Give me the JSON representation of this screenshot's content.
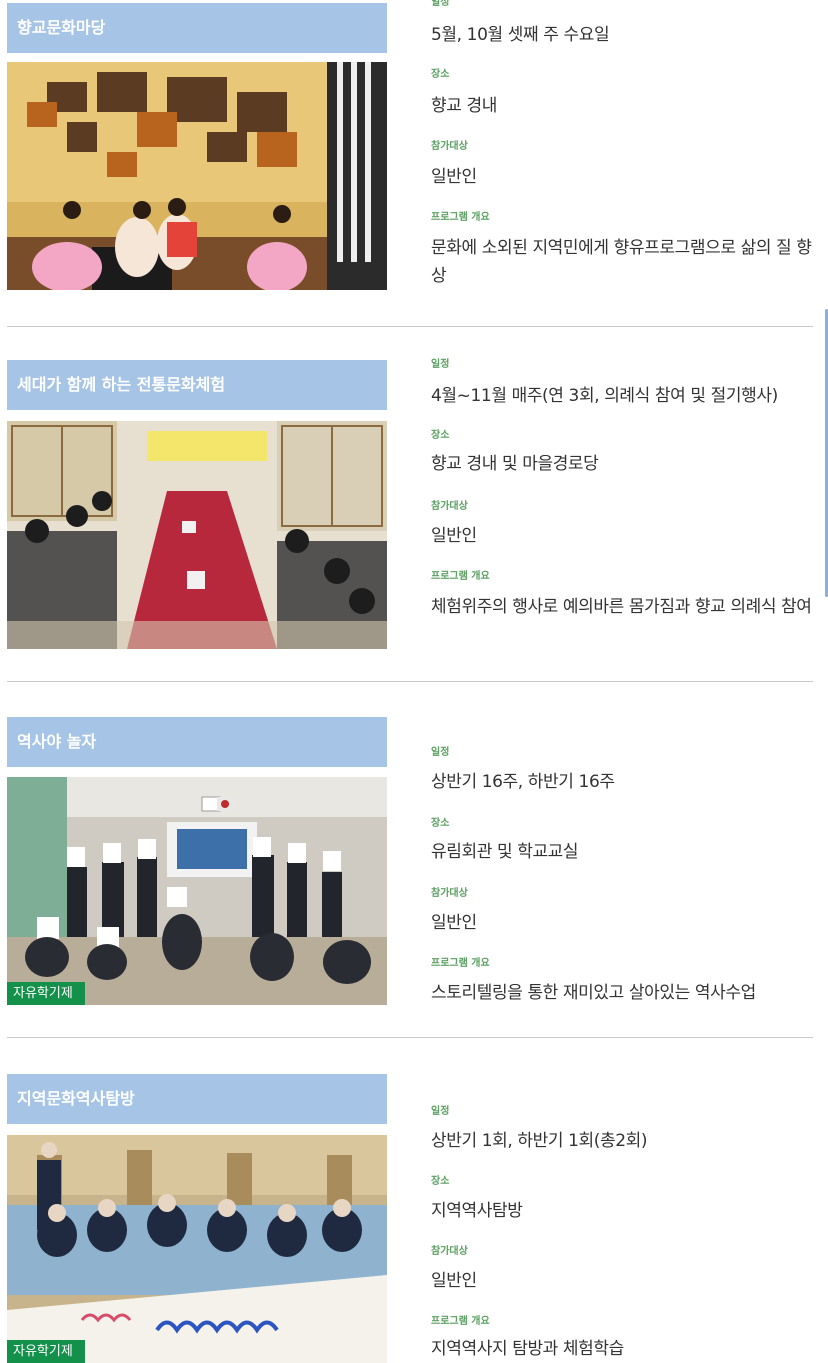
{
  "labels": {
    "schedule": "일정",
    "place": "장소",
    "target": "참가대상",
    "overview": "프로그램 개요"
  },
  "programs": [
    {
      "title": "향교문화마당",
      "schedule": "5월, 10월 셋째 주 수요일",
      "place": "향교 경내",
      "target": "일반인",
      "overview": "문화에 소외된 지역민에게 향유프로그램으로 삶의 질 향상",
      "badge": ""
    },
    {
      "title": "세대가 함께 하는 전통문화체험",
      "schedule": "4월~11월 매주(연 3회, 의례식 참여 및 절기행사)",
      "place": "향교 경내 및 마을경로당",
      "target": "일반인",
      "overview": "체험위주의 행사로 예의바른 몸가짐과 향교 의례식 참여",
      "badge": ""
    },
    {
      "title": "역사야 놀자",
      "schedule": "상반기 16주, 하반기 16주",
      "place": "유림회관 및 학교교실",
      "target": "일반인",
      "overview": "스토리텔링을 통한 재미있고 살아있는 역사수업",
      "badge": "자유학기제"
    },
    {
      "title": "지역문화역사탐방",
      "schedule": "상반기 1회, 하반기 1회(총2회)",
      "place": "지역역사탐방",
      "target": "일반인",
      "overview": "지역역사지 탐방과 체험학습",
      "badge": "자유학기제"
    }
  ],
  "colors": {
    "banner": "#a6c4e5",
    "label": "#5ba062",
    "badge": "#13914b",
    "divider": "#c9c9c9"
  }
}
